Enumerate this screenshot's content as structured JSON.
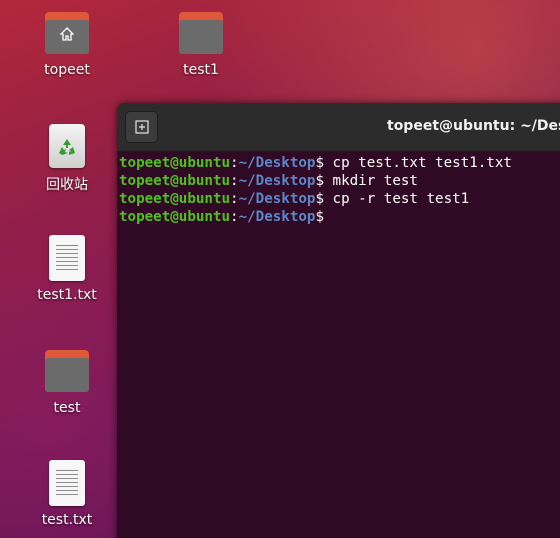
{
  "desktop": {
    "icons": [
      {
        "label": "topeet",
        "kind": "home-folder"
      },
      {
        "label": "test1",
        "kind": "folder"
      },
      {
        "label": "回收站",
        "kind": "trash"
      },
      {
        "label": "test1.txt",
        "kind": "text-file"
      },
      {
        "label": "test",
        "kind": "folder"
      },
      {
        "label": "test.txt",
        "kind": "text-file"
      }
    ]
  },
  "terminal": {
    "title": "topeet@ubuntu: ~/Desktop",
    "new_tab_icon": "new-tab-icon",
    "prompt": {
      "user": "topeet@ubuntu",
      "colon": ":",
      "path": "~/Desktop",
      "dollar": "$"
    },
    "lines": [
      {
        "command": " cp test.txt test1.txt"
      },
      {
        "command": " mkdir test"
      },
      {
        "command": " cp -r test test1"
      },
      {
        "command": ""
      }
    ],
    "colors": {
      "background": "#300a24",
      "user": "#4fc21c",
      "path": "#5d86c9"
    }
  }
}
